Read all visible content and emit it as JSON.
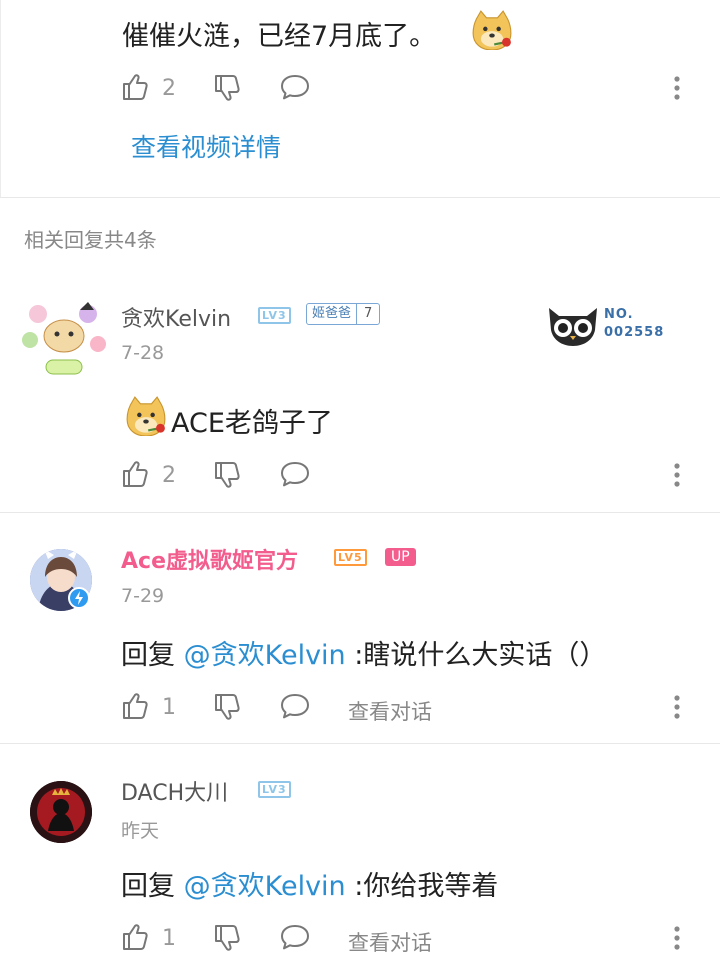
{
  "top_comment": {
    "text": "催催火涟，已经7月底了。",
    "likes": "2",
    "view_video_link": "查看视频详情"
  },
  "replies_header": "相关回复共4条",
  "replies": [
    {
      "username": "贪欢Kelvin",
      "level": "LV3",
      "fan_badge_name": "姬爸爸",
      "fan_badge_level": "7",
      "garb_no_label": "NO.",
      "garb_no_number": "002558",
      "date": "7-28",
      "text": "ACE老鸽子了",
      "likes": "2"
    },
    {
      "username": "Ace虚拟歌姬官方",
      "level": "LV5",
      "up_badge": "UP",
      "date": "7-29",
      "reply_prefix": "回复 ",
      "mention": "@贪欢Kelvin",
      "text": " :瞎说什么大实话（）",
      "likes": "1",
      "view_dialog": "查看对话"
    },
    {
      "username": "DACH大川",
      "level": "LV3",
      "date": "昨天",
      "reply_prefix": "回复 ",
      "mention": "@贪欢Kelvin",
      "text": " :你给我等着",
      "likes": "1",
      "view_dialog": "查看对话"
    }
  ],
  "colors": {
    "link": "#2b8ed1",
    "up_name": "#f25d8e",
    "level_blue": "#8ec5e8",
    "level_orange": "#ff9a3c"
  },
  "icons": [
    "thumb-up-icon",
    "thumb-down-icon",
    "comment-icon",
    "more-vertical-icon",
    "doge-emoji-icon",
    "verified-icon",
    "cat-garb-icon"
  ]
}
